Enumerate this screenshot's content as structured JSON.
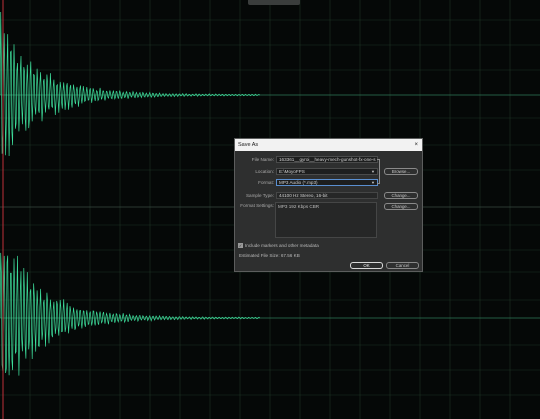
{
  "dialog": {
    "title": "Save As",
    "close_icon": "×",
    "file_name_label": "File Name:",
    "file_name_value": "163361__gyroi__heavy-mech-gunshot-fx-one-s",
    "location_label": "Location:",
    "location_value": "E:\\MoyoFPS",
    "format_label": "Format:",
    "format_value": "MP3 Audio (*.mp3)",
    "sample_type_label": "Sample Type:",
    "sample_type_value": "44100 Hz Stereo, 16-bit",
    "format_settings_label": "Format Settings:",
    "format_settings_value": "MP3 192 Kbps CBR",
    "browse_label": "Browse...",
    "change_label_1": "Change...",
    "change_label_2": "Change...",
    "include_markers_label": "Include markers and other metadata",
    "include_markers_checked": true,
    "estimated_size": "Estimated File Size: 67.56 KB",
    "ok_label": "OK",
    "cancel_label": "Cancel"
  },
  "colors": {
    "waveform": "#3ddc9a",
    "grid": "#1c3324",
    "background": "#050807",
    "playhead": "#c0303a"
  }
}
